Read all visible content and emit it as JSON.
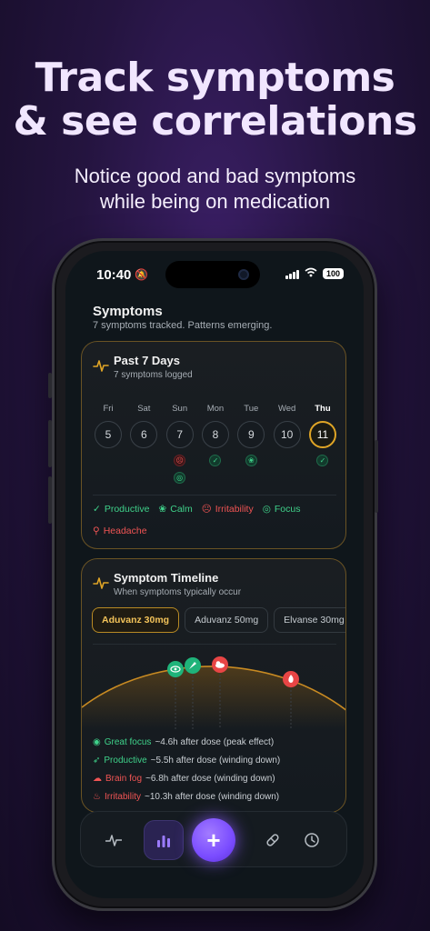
{
  "promo": {
    "headline_line1": "Track symptoms",
    "headline_line2": "& see correlations",
    "subhead_line1": "Notice good and bad symptoms",
    "subhead_line2": "while being on medication"
  },
  "status_bar": {
    "time": "10:40",
    "battery": "100"
  },
  "page": {
    "title": "Symptoms",
    "subtitle": "7 symptoms tracked. Patterns emerging."
  },
  "past7": {
    "title": "Past 7 Days",
    "subtitle": "7 symptoms logged",
    "days": [
      {
        "name": "Fri",
        "num": "5",
        "today": false,
        "marks": []
      },
      {
        "name": "Sat",
        "num": "6",
        "today": false,
        "marks": []
      },
      {
        "name": "Sun",
        "num": "7",
        "today": false,
        "marks": [
          "irritability",
          "focus"
        ]
      },
      {
        "name": "Mon",
        "num": "8",
        "today": false,
        "marks": [
          "productive"
        ]
      },
      {
        "name": "Tue",
        "num": "9",
        "today": false,
        "marks": [
          "calm"
        ]
      },
      {
        "name": "Wed",
        "num": "10",
        "today": false,
        "marks": []
      },
      {
        "name": "Thu",
        "num": "11",
        "today": true,
        "marks": [
          "productive"
        ]
      }
    ],
    "legend": [
      {
        "label": "Productive",
        "tone": "green",
        "icon": "check-circle-icon"
      },
      {
        "label": "Calm",
        "tone": "green",
        "icon": "lotus-icon"
      },
      {
        "label": "Irritability",
        "tone": "red",
        "icon": "frown-icon"
      },
      {
        "label": "Focus",
        "tone": "green",
        "icon": "target-icon"
      },
      {
        "label": "Headache",
        "tone": "red",
        "icon": "pin-icon"
      }
    ]
  },
  "timeline": {
    "title": "Symptom Timeline",
    "subtitle": "When symptoms typically occur",
    "medications": [
      {
        "label": "Aduvanz 30mg",
        "active": true
      },
      {
        "label": "Aduvanz 50mg",
        "active": false
      },
      {
        "label": "Elvanse 30mg",
        "active": false
      }
    ],
    "events": [
      {
        "name": "Great focus",
        "detail": "~4.6h after dose (peak effect)",
        "tone": "green",
        "icon": "eye-icon"
      },
      {
        "name": "Productive",
        "detail": "~5.5h after dose (winding down)",
        "tone": "green",
        "icon": "rocket-icon"
      },
      {
        "name": "Brain fog",
        "detail": "~6.8h after dose (winding down)",
        "tone": "red",
        "icon": "cloud-icon"
      },
      {
        "name": "Irritability",
        "detail": "~10.3h after dose (winding down)",
        "tone": "red",
        "icon": "flame-icon"
      }
    ]
  },
  "colors": {
    "accent_purple": "#7a4cff",
    "accent_gold": "#e0a526",
    "positive": "#3fd18a",
    "negative": "#f05454"
  },
  "nav": {
    "items": [
      "pulse-icon",
      "bar-chart-icon",
      "plus-icon",
      "pill-icon",
      "clock-icon"
    ]
  }
}
